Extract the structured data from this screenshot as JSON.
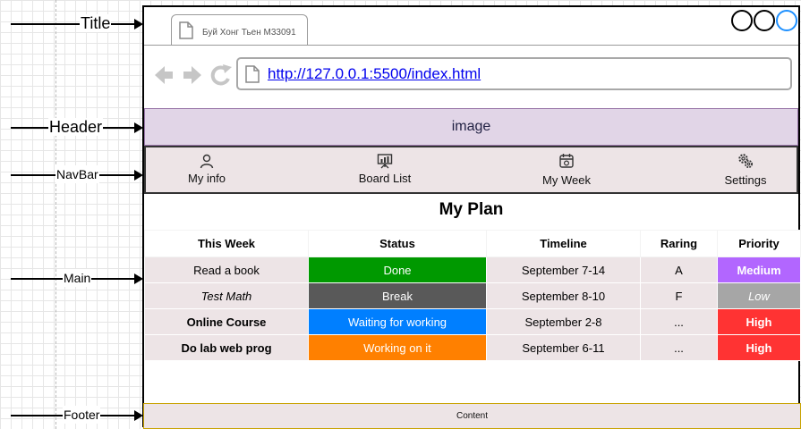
{
  "annotations": {
    "title": "Title",
    "header": "Header",
    "navbar": "NavBar",
    "main": "Main",
    "footer": "Footer"
  },
  "browser": {
    "tab_title": "Буй Хонг Тьен М33091",
    "url": "http://127.0.0.1:5500/index.html",
    "window_buttons": [
      "close",
      "minimize",
      "maximize"
    ],
    "accent_color": "#1e90ff"
  },
  "header": {
    "placeholder": "image"
  },
  "navbar": {
    "items": [
      {
        "label": "My info",
        "icon": "user-icon"
      },
      {
        "label": "Board List",
        "icon": "board-icon"
      },
      {
        "label": "My Week",
        "icon": "calendar-icon"
      },
      {
        "label": "Settings",
        "icon": "gears-icon"
      }
    ]
  },
  "main": {
    "title": "My Plan",
    "columns": [
      "This Week",
      "Status",
      "Timeline",
      "Raring",
      "Priority"
    ],
    "rows": [
      {
        "task": "Read a book",
        "status": "Done",
        "timeline": "September 7-14",
        "rating": "A",
        "priority": "Medium",
        "status_color": "#009900",
        "priority_color": "#b266ff"
      },
      {
        "task": "Test Math",
        "status": "Break",
        "timeline": "September 8-10",
        "rating": "F",
        "priority": "Low",
        "status_color": "#595959",
        "priority_color": "#a6a6a6"
      },
      {
        "task": "Online Course",
        "status": "Waiting for working",
        "timeline": "September 2-8",
        "rating": "...",
        "priority": "High",
        "status_color": "#007fff",
        "priority_color": "#ff3333"
      },
      {
        "task": "Do lab web prog",
        "status": "Working on it",
        "timeline": "September 6-11",
        "rating": "...",
        "priority": "High",
        "status_color": "#ff8000",
        "priority_color": "#ff3333"
      }
    ]
  },
  "footer": {
    "content": "Content"
  }
}
